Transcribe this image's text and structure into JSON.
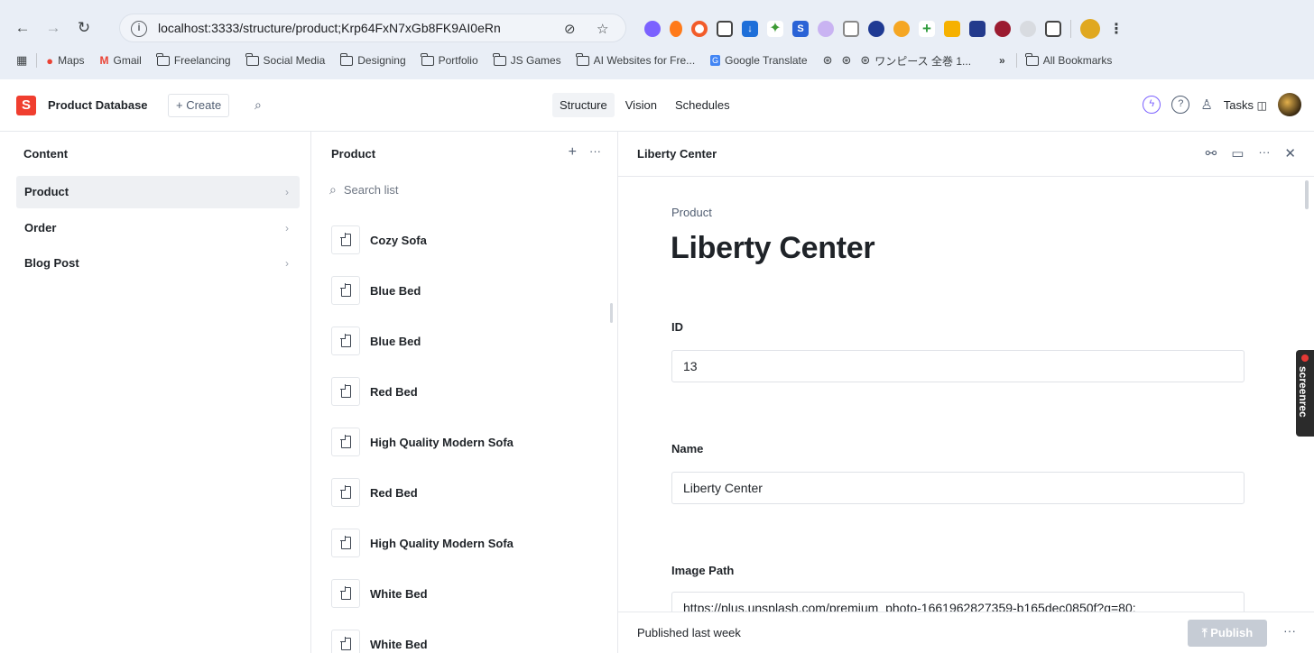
{
  "browser": {
    "url": "localhost:3333/structure/product;Krp64FxN7xGb8FK9AI0eRn",
    "bookmarks": [
      "Maps",
      "Gmail",
      "Freelancing",
      "Social Media",
      "Designing",
      "Portfolio",
      "JS Games",
      "AI Websites for Fre...",
      "Google Translate",
      "ワンピース 全巻 1..."
    ],
    "all_bookmarks": "All Bookmarks",
    "overflow": "»"
  },
  "app": {
    "title": "Product Database",
    "create": "+ Create",
    "tabs": [
      "Structure",
      "Vision",
      "Schedules"
    ],
    "active_tab": "Structure",
    "tasks": "Tasks"
  },
  "content_pane": {
    "title": "Content",
    "items": [
      "Product",
      "Order",
      "Blog Post"
    ],
    "selected": "Product"
  },
  "list_pane": {
    "title": "Product",
    "search_placeholder": "Search list",
    "items": [
      "Cozy Sofa",
      "Blue Bed",
      "Blue Bed",
      "Red Bed",
      "High Quality Modern Sofa",
      "Red Bed",
      "High Quality Modern Sofa",
      "White Bed",
      "White Bed"
    ]
  },
  "document": {
    "header_title": "Liberty Center",
    "type": "Product",
    "title": "Liberty Center",
    "fields": [
      {
        "label": "ID",
        "value": "13"
      },
      {
        "label": "Name",
        "value": "Liberty Center"
      },
      {
        "label": "Image Path",
        "value": "https://plus.unsplash.com/premium_photo-1661962827359-b165dec0850f?q=80;"
      }
    ],
    "status": "Published last week",
    "publish": "Publish"
  },
  "overlay": {
    "screenrec": "screenrec"
  }
}
